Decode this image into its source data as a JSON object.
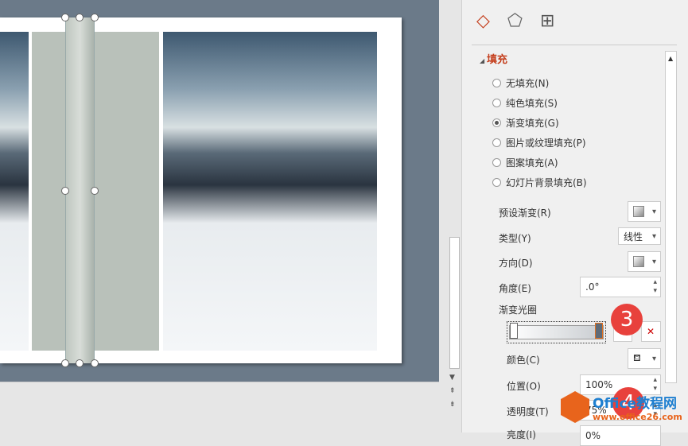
{
  "panel": {
    "tabs": [
      "fill-line",
      "effects",
      "size-properties"
    ],
    "section_title": "填充",
    "fill_options": [
      {
        "label": "无填充(N)",
        "selected": false
      },
      {
        "label": "纯色填充(S)",
        "selected": false
      },
      {
        "label": "渐变填充(G)",
        "selected": true
      },
      {
        "label": "图片或纹理填充(P)",
        "selected": false
      },
      {
        "label": "图案填充(A)",
        "selected": false
      },
      {
        "label": "幻灯片背景填充(B)",
        "selected": false
      }
    ],
    "preset_label": "预设渐变(R)",
    "type_label": "类型(Y)",
    "type_value": "线性",
    "direction_label": "方向(D)",
    "angle_label": "角度(E)",
    "angle_value": ".0°",
    "stops_label": "渐变光圈",
    "color_label": "颜色(C)",
    "position_label": "位置(O)",
    "position_value": "100%",
    "transparency_label": "透明度(T)",
    "transparency_value": "75%",
    "brightness_label": "亮度(I)",
    "brightness_value": "0%"
  },
  "badges": [
    "3",
    "4"
  ],
  "watermark": {
    "name": "Office教程网",
    "url": "www.office26.com"
  }
}
